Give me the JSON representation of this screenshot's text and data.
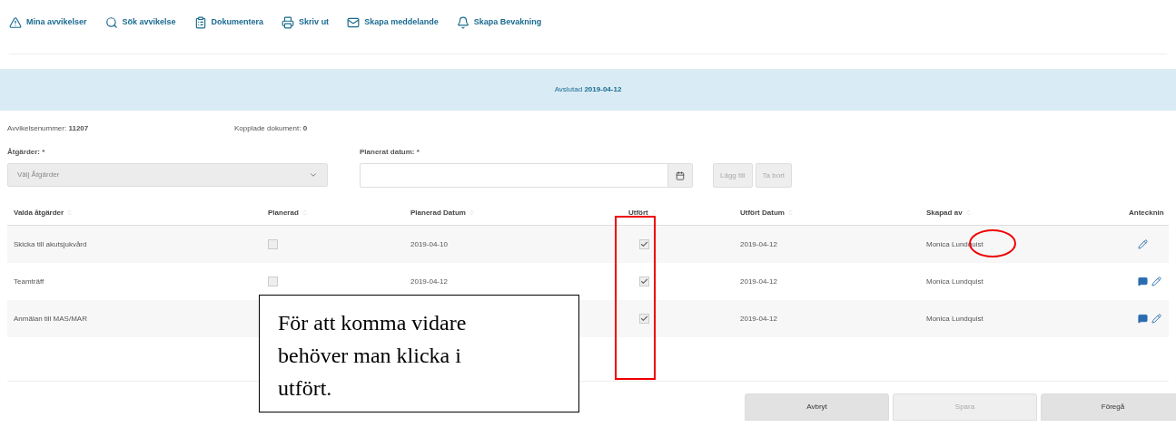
{
  "toolbar": [
    {
      "kind": "warning",
      "label": "Mina avvikelser"
    },
    {
      "kind": "search",
      "label": "Sök avvikelse"
    },
    {
      "kind": "clipboard",
      "label": "Dokumentera"
    },
    {
      "kind": "print",
      "label": "Skriv ut"
    },
    {
      "kind": "mail",
      "label": "Skapa meddelande"
    },
    {
      "kind": "bell",
      "label": "Skapa Bevakning"
    }
  ],
  "banner": {
    "label": "Avslutad",
    "value": "2019-04-12"
  },
  "info": [
    {
      "label": "Avvikelsenummer:",
      "value": "11207"
    },
    {
      "label": "Kopplade dokument:",
      "value": "0"
    }
  ],
  "form": {
    "actions_label": "Åtgärder: *",
    "actions_select": "Välj Åtgärder",
    "date_label": "Planerat datum: *",
    "add_button": {
      "label": "Lägg till",
      "disabled": true
    },
    "remove_button": {
      "label": "Ta bort",
      "disabled": true
    }
  },
  "table": {
    "columns": [
      "Valda åtgärder",
      "Planerad",
      "Planerad Datum",
      "Utfört",
      "Utfört Datum",
      "Skapad av",
      "Antecknin"
    ],
    "rows": [
      {
        "action": "Skicka till akutsjukvård",
        "planned": false,
        "planned_date": "2019-04-10",
        "done": true,
        "done_date": "2019-04-12",
        "created_by": "Monica Lundquist",
        "comment": false,
        "edit": true
      },
      {
        "action": "Teamträff",
        "planned": false,
        "planned_date": "2019-04-12",
        "done": true,
        "done_date": "2019-04-12",
        "created_by": "Monica Lundquist",
        "comment": true,
        "edit": true
      },
      {
        "action": "Anmälan till MAS/MAR",
        "done": true,
        "done_date": "2019-04-12",
        "created_by": "Monica Lundquist",
        "comment": true,
        "edit": true
      }
    ]
  },
  "buttons": [
    {
      "label": "Avbryt",
      "disabled": false
    },
    {
      "label": "Spara",
      "disabled": true
    },
    {
      "label": "Föregå",
      "disabled": false
    }
  ],
  "callout": "För att komma vidare behöver man klicka i utfört."
}
